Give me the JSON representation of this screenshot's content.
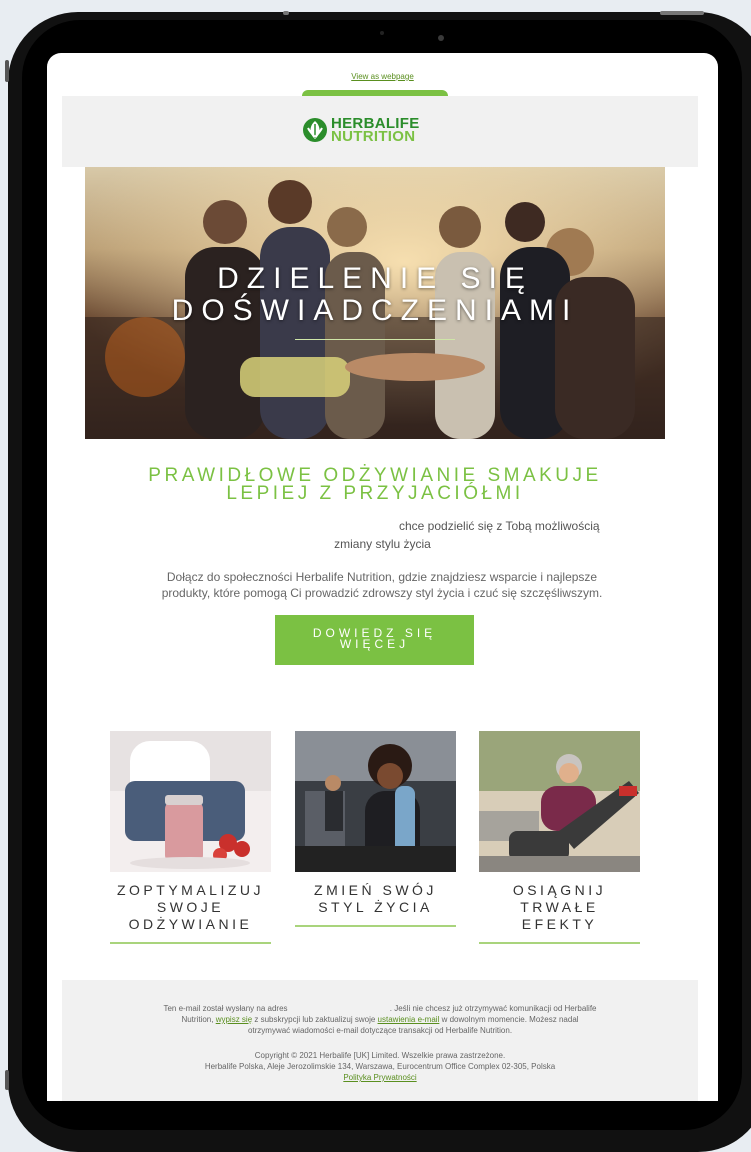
{
  "email": {
    "view_as_webpage": "View as webpage",
    "brand": {
      "line1": "HERBALIFE",
      "line2": "NUTRITION",
      "color_dark": "#2b8d2b",
      "color_light": "#7bc143"
    },
    "hero": {
      "title_line1": "DZIELENIE SIĘ",
      "title_line2": "DOŚWIADCZENIAMI"
    },
    "subheading": {
      "line1": "PRAWIDŁOWE ODŻYWIANIE SMAKUJE",
      "line2": "LEPIEJ Z PRZYJACIÓŁMI"
    },
    "intro": {
      "line1": "chce podzielić się z Tobą możliwością",
      "line2": "zmiany stylu życia"
    },
    "paragraph": {
      "line1": "Dołącz do społeczności Herbalife Nutrition, gdzie znajdziesz wsparcie i najlepsze",
      "line2": "produkty, które pomogą Ci prowadzić zdrowszy styl życia i czuć się szczęśliwszym."
    },
    "cta": {
      "line1": "DOWIEDZ SIĘ",
      "line2": "WIĘCEJ"
    },
    "cards": [
      {
        "line1": "ZOPTYMALIZUJ",
        "line2": "SWOJE",
        "line3": "ODŻYWIANIE"
      },
      {
        "line1": "ZMIEŃ SWÓJ",
        "line2": "STYL ŻYCIA",
        "line3": ""
      },
      {
        "line1": "OSIĄGNIJ",
        "line2": "TRWAŁE",
        "line3": "EFEKTY"
      }
    ],
    "footer": {
      "t1": "Ten e-mail został wysłany na adres",
      "t2": ". Jeśli nie chcesz już otrzymywać komunikacji od Herbalife",
      "t3": "Nutrition,",
      "unsubscribe": "wypisz się",
      "t4": "z subskrypcji lub zaktualizuj swoje",
      "settings": "ustawienia e-mail",
      "t5": "w dowolnym momencie. Możesz nadal",
      "t6": "otrzymywać wiadomości e-mail dotyczące transakcji od Herbalife Nutrition.",
      "copyright": "Copyright © 2021 Herbalife [UK] Limited. Wszelkie prawa zastrzeżone.",
      "address": "Herbalife Polska, Aleje Jerozolimskie 134, Warszawa, Eurocentrum Office Complex 02-305, Polska",
      "privacy": "Polityka Prywatności"
    },
    "accent_color": "#7bc143"
  }
}
